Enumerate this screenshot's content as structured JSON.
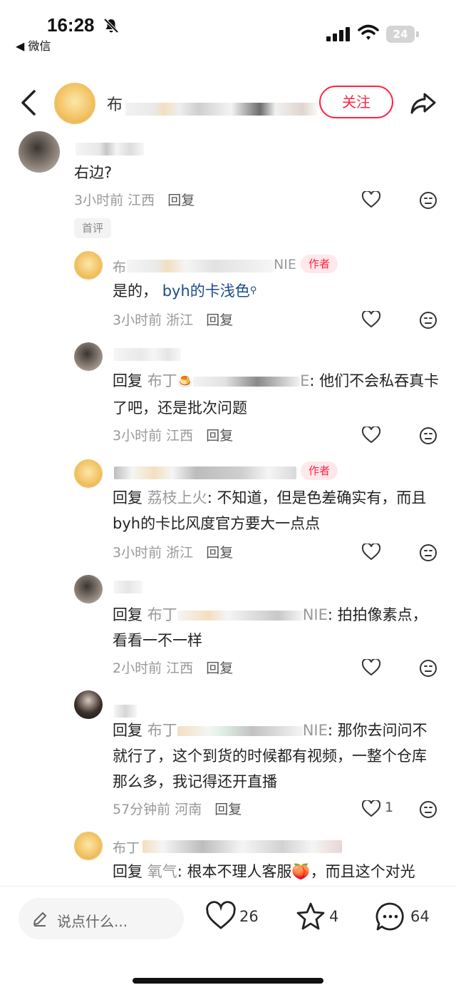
{
  "status_bar": {
    "time": "16:28",
    "back_app": "◀ 微信",
    "battery": "24"
  },
  "header": {
    "author_prefix": "布",
    "follow_label": "关注"
  },
  "comments": [
    {
      "nick": "",
      "text": "右边?",
      "time": "3小时前",
      "region": "江西",
      "reply_label": "回复",
      "badge": "首评"
    },
    {
      "nick": "布",
      "nick_suffix": "NIE",
      "is_author": true,
      "author_tag": "作者",
      "text_plain": "是的，",
      "text_link": "byh的卡浅色",
      "time": "3小时前",
      "region": "浙江",
      "reply_label": "回复"
    },
    {
      "nick": "",
      "reply_word": "回复",
      "reply_target": "布丁",
      "reply_target_tail": "E",
      "text": ": 他们不会私吞真卡了吧，还是批次问题",
      "time": "3小时前",
      "region": "江西",
      "reply_label": "回复"
    },
    {
      "nick": "",
      "is_author": true,
      "author_tag": "作者",
      "reply_word": "回复",
      "reply_target": "荔枝上火",
      "text": ": 不知道，但是色差确实有，而且byh的卡比风度官方要大一点点",
      "time": "3小时前",
      "region": "浙江",
      "reply_label": "回复"
    },
    {
      "nick": "",
      "reply_word": "回复",
      "reply_target": "布丁",
      "reply_target_tail": "NIE",
      "text": ": 拍拍像素点，看看一不一样",
      "time": "2小时前",
      "region": "江西",
      "reply_label": "回复"
    },
    {
      "nick": "",
      "reply_word": "回复",
      "reply_target": "布丁",
      "reply_target_tail": "NIE",
      "text": ": 那你去问问不就行了，这个到货的时候都有视频，一整个仓库那么多，我记得还开直播",
      "time": "57分钟前",
      "region": "河南",
      "reply_label": "回复",
      "likes": "1"
    },
    {
      "nick": "布丁",
      "reply_word": "回复",
      "reply_target": "氧气",
      "text": ": 根本不理人客服🍑，而且这个对光"
    }
  ],
  "bottom_bar": {
    "placeholder": "说点什么...",
    "likes": "26",
    "favorites": "4",
    "comments": "64"
  },
  "colors": {
    "accent": "#ff2442",
    "link": "#1b4c8a",
    "muted": "#999999"
  }
}
